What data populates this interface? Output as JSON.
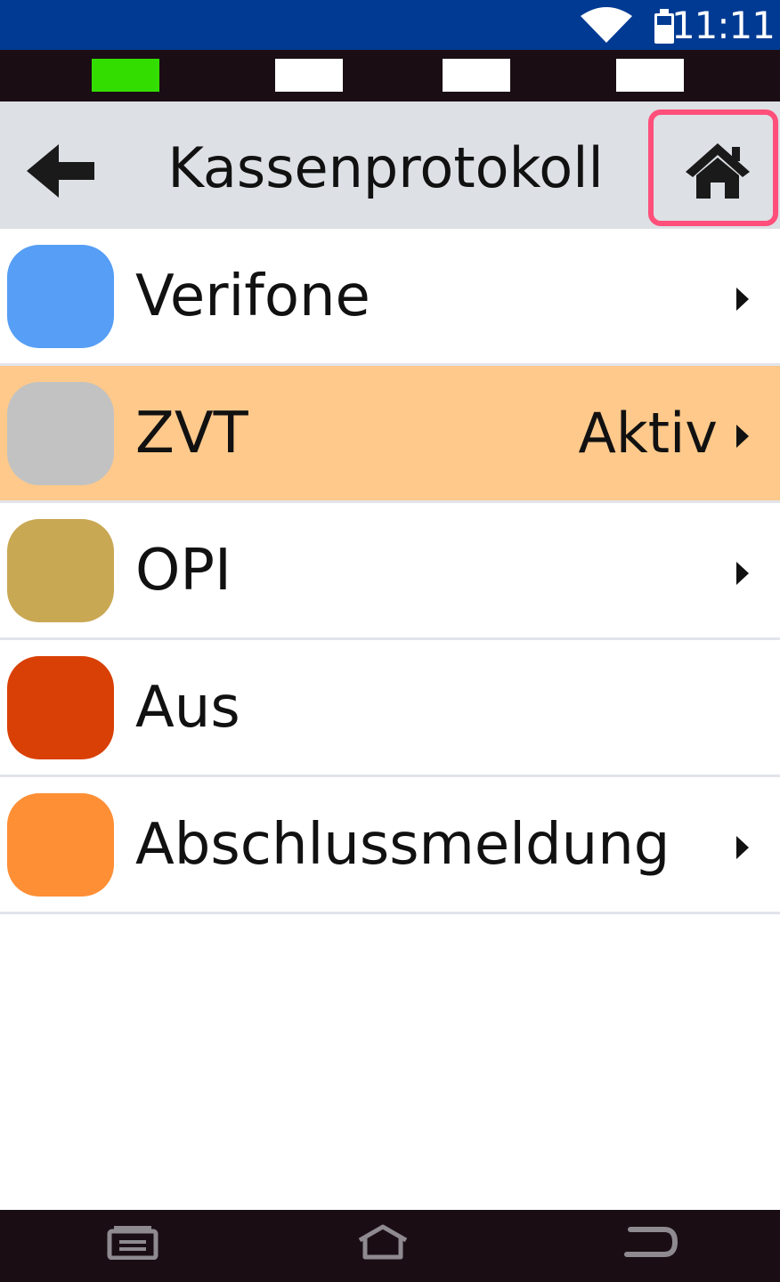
{
  "status_bar": {
    "time": "11:11",
    "icons": [
      "wifi-icon",
      "battery-icon"
    ],
    "background": "#003a93"
  },
  "indicators": [
    {
      "name": "indicator-1",
      "color": "#33dd00"
    },
    {
      "name": "indicator-2",
      "color": "#ffffff"
    },
    {
      "name": "indicator-3",
      "color": "#ffffff"
    },
    {
      "name": "indicator-4",
      "color": "#ffffff"
    }
  ],
  "header": {
    "title": "Kassenprotokoll",
    "back_icon": "arrow-left-icon",
    "home_icon": "home-icon",
    "highlight_color": "#ff4f7a"
  },
  "list": {
    "items": [
      {
        "label": "Verifone",
        "status": "",
        "color": "#569ef6",
        "active": false,
        "chevron": true
      },
      {
        "label": "ZVT",
        "status": "Aktiv",
        "color": "#c2c2c2",
        "active": true,
        "chevron": true
      },
      {
        "label": "OPI",
        "status": "",
        "color": "#c9a854",
        "active": false,
        "chevron": true
      },
      {
        "label": "Aus",
        "status": "",
        "color": "#d94005",
        "active": false,
        "chevron": false
      },
      {
        "label": "Abschlussmeldung",
        "status": "",
        "color": "#fe8f35",
        "active": false,
        "chevron": true
      }
    ],
    "active_background": "#fec98b"
  },
  "nav_bar": {
    "icons": [
      "recent-apps-icon",
      "home-nav-icon",
      "back-nav-icon"
    ]
  }
}
